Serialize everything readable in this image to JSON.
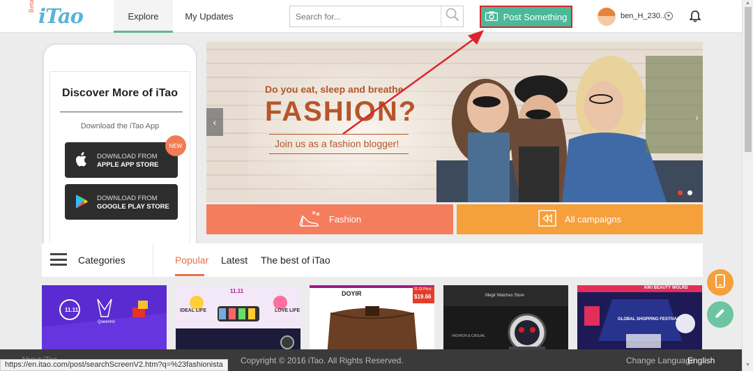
{
  "header": {
    "logo_beta": "Beta",
    "logo_text": "iTao",
    "tabs": [
      {
        "label": "Explore",
        "active": true
      },
      {
        "label": "My Updates",
        "active": false
      }
    ],
    "search_placeholder": "Search for...",
    "post_label": "Post Something",
    "username": "ben_H_230...",
    "icons": [
      "search-icon",
      "camera-icon",
      "chevron-down-icon",
      "bell-icon"
    ]
  },
  "sidebar": {
    "title": "Discover More of iTao",
    "subtitle": "Download the iTao App",
    "new_badge": "NEW",
    "apple": {
      "line1": "DOWNLOAD FROM",
      "line2": "APPLE APP STORE"
    },
    "google": {
      "line1": "DOWNLOAD FROM",
      "line2": "GOOGLE PLAY STORE"
    }
  },
  "banner": {
    "tagline": "Do you eat, sleep and breathe",
    "headline": "FASHION?",
    "cta": "Join us as a fashion blogger!",
    "slide_count": 2,
    "active_slide": 1
  },
  "campaigns": [
    {
      "label": "Fashion",
      "color": "#f47d5e"
    },
    {
      "label": "All campaigns",
      "color": "#f5a03b"
    }
  ],
  "categories": {
    "label": "Categories",
    "tabs": [
      {
        "label": "Popular",
        "active": true
      },
      {
        "label": "Latest",
        "active": false
      },
      {
        "label": "The best of iTao",
        "active": false
      }
    ]
  },
  "products": [
    {
      "badge": "11.11",
      "caption": "Queenrol",
      "bg": "#5a2bd0"
    },
    {
      "badge": "11.11",
      "caption": "IDEAL LIFE",
      "caption2": "LOVE LIFE",
      "bg": "#f0e4f5"
    },
    {
      "badge": "DOYIR",
      "price": "11.11 Price",
      "price_value": "$19.66",
      "bg": "#ffffff"
    },
    {
      "badge": "Megir Watches Store",
      "caption": "FASHION & CASUAL",
      "bg": "#2a2a2a"
    },
    {
      "badge": "KIKI BEAUTY WOLRD",
      "caption": "GLOBAL SHOPPING FESTIVAL",
      "bg": "#1d1a55"
    }
  ],
  "footer": {
    "about": "About iTao",
    "copyright": "Copyright © 2016 iTao. All Rights Reserved.",
    "change_language": "Change Language",
    "language": "English"
  },
  "status_url": "https://en.itao.com/post/searchScreenV2.htm?q=%23fashionista",
  "colors": {
    "accent_green": "#4bb898",
    "annotation_red": "#d9262b",
    "brand_orange": "#e8704b",
    "brand_blue": "#5ab4d6"
  }
}
